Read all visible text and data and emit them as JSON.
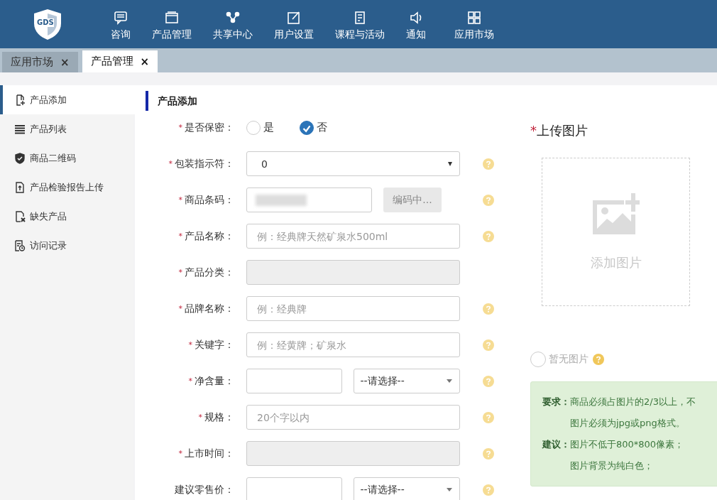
{
  "nav": [
    {
      "label": "咨询"
    },
    {
      "label": "产品管理"
    },
    {
      "label": "共享中心"
    },
    {
      "label": "用户设置"
    },
    {
      "label": "课程与活动"
    },
    {
      "label": "通知"
    },
    {
      "label": "应用市场"
    }
  ],
  "logo": "GDS",
  "tabs": [
    {
      "label": "应用市场",
      "close": "×",
      "selected": false
    },
    {
      "label": "产品管理",
      "close": "×",
      "selected": true
    }
  ],
  "sidebar": {
    "items": [
      {
        "label": "产品添加",
        "selected": true
      },
      {
        "label": "产品列表",
        "selected": false
      },
      {
        "label": "商品二维码",
        "selected": false
      },
      {
        "label": "产品检验报告上传",
        "selected": false
      },
      {
        "label": "缺失产品",
        "selected": false
      },
      {
        "label": "访问记录",
        "selected": false
      }
    ]
  },
  "form": {
    "title": "产品添加",
    "rows": [
      {
        "kind": "radio",
        "label": "是否保密：",
        "required_mark": "*",
        "help": false,
        "options": [
          {
            "label": "是",
            "selected": false
          },
          {
            "label": "否",
            "selected": true
          }
        ]
      },
      {
        "kind": "select",
        "label": "包装指示符：",
        "required_mark": "*",
        "help": true,
        "value": "0"
      },
      {
        "kind": "barcode",
        "label": "商品条码：",
        "required_mark": "*",
        "help": true,
        "button": "编码中..."
      },
      {
        "kind": "text",
        "label": "产品名称：",
        "required_mark": "*",
        "help": true,
        "placeholder": "例：经典牌天然矿泉水500ml"
      },
      {
        "kind": "disabled",
        "label": "产品分类：",
        "required_mark": "*",
        "help": false
      },
      {
        "kind": "text",
        "label": "品牌名称：",
        "required_mark": "*",
        "help": true,
        "placeholder": "例：经典牌"
      },
      {
        "kind": "text",
        "label": "关键字：",
        "required_mark": "*",
        "help": true,
        "placeholder": "例：经黄牌；矿泉水"
      },
      {
        "kind": "combo",
        "label": "净含量：",
        "required_mark": "*",
        "help": true,
        "value": "--请选择--"
      },
      {
        "kind": "text",
        "label": "规格：",
        "required_mark": "*",
        "help": true,
        "placeholder": "20个字以内"
      },
      {
        "kind": "disabled",
        "label": "上市时间：",
        "required_mark": "*",
        "help": true
      },
      {
        "kind": "combo",
        "label": "建议零售价：",
        "help": true,
        "value": "--请选择--"
      }
    ]
  },
  "upload": {
    "title": "上传图片",
    "required_mark": "*",
    "add_label": "添加图片",
    "no_image": {
      "label": "暂无图片",
      "checked": false
    },
    "notes": [
      {
        "term": "要求：",
        "lines": [
          "商品必须占图片的2/3以上，不",
          "图片必须为jpg或png格式。"
        ]
      },
      {
        "term": "建议：",
        "lines": [
          "图片不低于800*800像素；",
          "图片背景为纯白色；"
        ]
      }
    ]
  }
}
